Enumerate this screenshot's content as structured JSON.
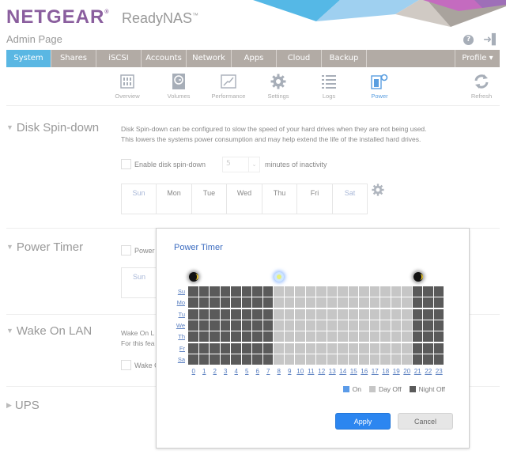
{
  "header": {
    "brand": "NETGEAR",
    "product": "ReadyNAS",
    "product_mark": "™",
    "subtitle": "Admin Page",
    "help_icon": "help-circle-icon",
    "logout_icon": "logout-icon"
  },
  "nav": {
    "tabs": [
      {
        "label": "System",
        "active": true
      },
      {
        "label": "Shares"
      },
      {
        "label": "iSCSI"
      },
      {
        "label": "Accounts"
      },
      {
        "label": "Network"
      },
      {
        "label": "Apps"
      },
      {
        "label": "Cloud"
      },
      {
        "label": "Backup"
      }
    ],
    "profile": "Profile ▾"
  },
  "subnav": {
    "items": [
      {
        "label": "Overview",
        "icon": "overview-icon"
      },
      {
        "label": "Volumes",
        "icon": "volumes-icon"
      },
      {
        "label": "Performance",
        "icon": "performance-icon"
      },
      {
        "label": "Settings",
        "icon": "gear-icon"
      },
      {
        "label": "Logs",
        "icon": "logs-icon"
      },
      {
        "label": "Power",
        "icon": "power-icon",
        "active": true
      }
    ],
    "refresh": "Refresh"
  },
  "disk_spindown": {
    "title": "Disk Spin-down",
    "desc_line1": "Disk Spin-down can be configured to slow the speed of your hard drives when they are not being used.",
    "desc_line2": "This lowers the systems power consumption and may help extend the life of the installed hard drives.",
    "enable_label": "Enable disk spin-down",
    "enabled": false,
    "minutes_value": "5",
    "minutes_label": "minutes of inactivity",
    "days": [
      "Sun",
      "Mon",
      "Tue",
      "Wed",
      "Thu",
      "Fri",
      "Sat"
    ]
  },
  "power_timer_section": {
    "title": "Power Timer",
    "checkbox_label_partial": "Power",
    "days_partial": [
      "Sun"
    ]
  },
  "wake_on_lan": {
    "title": "Wake On LAN",
    "desc_line1_partial": "Wake On L",
    "desc_line2_partial": "For this fea",
    "checkbox_label_partial": "Wake O"
  },
  "ups": {
    "title": "UPS"
  },
  "modal": {
    "title": "Power Timer",
    "row_labels": [
      "Su",
      "Mo",
      "Tu",
      "We",
      "Th",
      "Fr",
      "Sa"
    ],
    "hours": [
      "0",
      "1",
      "2",
      "3",
      "4",
      "5",
      "6",
      "7",
      "8",
      "9",
      "10",
      "11",
      "12",
      "13",
      "14",
      "15",
      "16",
      "17",
      "18",
      "19",
      "20",
      "21",
      "22",
      "23"
    ],
    "schedule_by_hour": [
      "night",
      "night",
      "night",
      "night",
      "night",
      "night",
      "night",
      "night",
      "day",
      "day",
      "day",
      "day",
      "day",
      "day",
      "day",
      "day",
      "day",
      "day",
      "day",
      "day",
      "day",
      "night",
      "night",
      "night"
    ],
    "markers": [
      {
        "type": "night",
        "hour": 0
      },
      {
        "type": "day",
        "hour": 8
      },
      {
        "type": "night",
        "hour": 21
      }
    ],
    "legend": [
      {
        "label": "On",
        "color": "#5b9be8"
      },
      {
        "label": "Day Off",
        "color": "#c6c6c6"
      },
      {
        "label": "Night Off",
        "color": "#5a5a5a"
      }
    ],
    "apply": "Apply",
    "cancel": "Cancel"
  },
  "colors": {
    "accent": "#5ab7e3",
    "nav_bg": "#b2aba5",
    "brand": "#8a5e9e",
    "link": "#5a7fc0",
    "apply": "#2c86f0"
  }
}
